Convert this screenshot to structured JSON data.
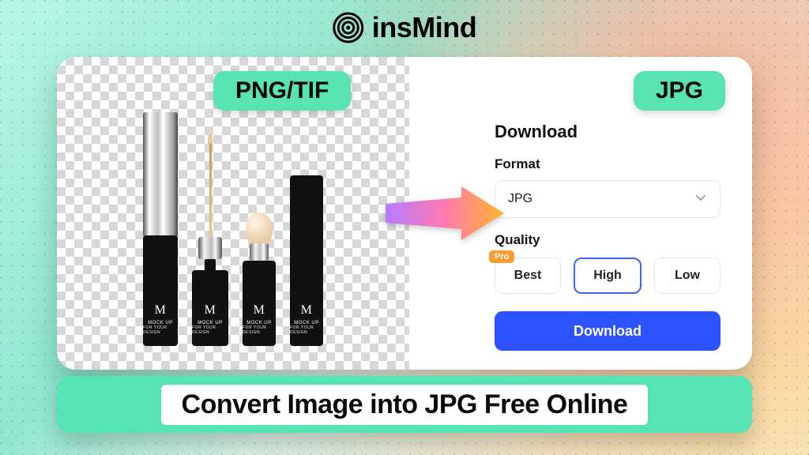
{
  "brand": {
    "name": "insMind"
  },
  "badges": {
    "source": "PNG/TIF",
    "target": "JPG"
  },
  "panel": {
    "title": "Download",
    "format_label": "Format",
    "format_value": "JPG",
    "quality_label": "Quality",
    "quality_options": [
      {
        "label": "Best",
        "pro": true,
        "selected": false
      },
      {
        "label": "High",
        "pro": false,
        "selected": true
      },
      {
        "label": "Low",
        "pro": false,
        "selected": false
      }
    ],
    "pro_tag": "Pro",
    "download_button": "Download"
  },
  "products": {
    "brand_letter": "M",
    "brand_line1": "MOCK UP",
    "brand_line2": "FOR YOUR DESIGN"
  },
  "footer": {
    "tagline": "Convert Image into JPG Free Online"
  }
}
